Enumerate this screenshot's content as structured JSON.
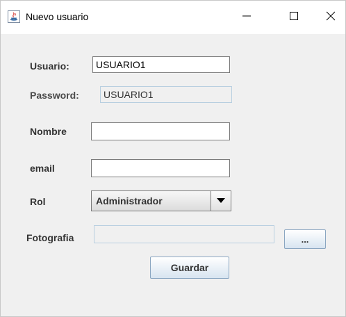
{
  "window": {
    "title": "Nuevo usuario"
  },
  "form": {
    "usuario": {
      "label": "Usuario:",
      "value": "USUARIO1"
    },
    "password": {
      "label": "Password:",
      "value": "USUARIO1"
    },
    "nombre": {
      "label": "Nombre",
      "value": ""
    },
    "email": {
      "label": "email",
      "value": ""
    },
    "rol": {
      "label": "Rol",
      "selected": "Administrador"
    },
    "fotografia": {
      "label": "Fotografia",
      "value": "",
      "browse_label": "..."
    },
    "guardar_label": "Guardar"
  }
}
